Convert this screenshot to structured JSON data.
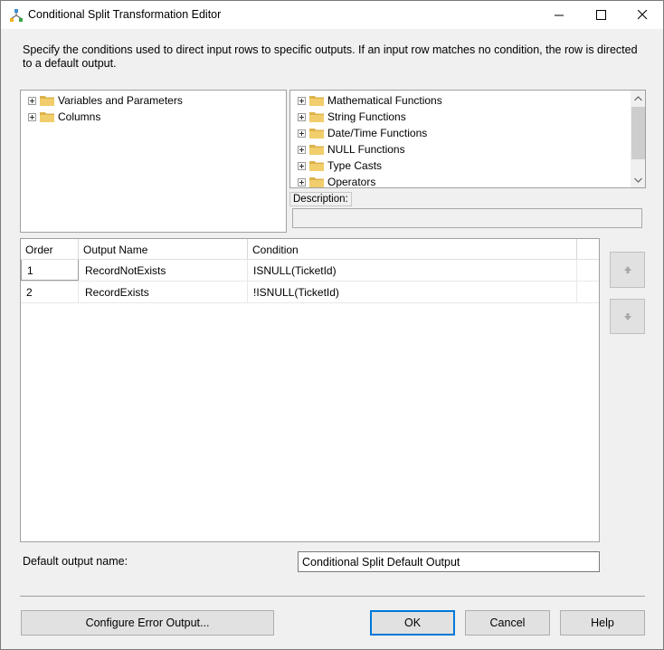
{
  "window": {
    "title": "Conditional Split Transformation Editor",
    "minimize_glyph": "—",
    "maximize_glyph": "☐",
    "close_glyph": "✕",
    "app_icon": "conditional-split-icon"
  },
  "description": "Specify the conditions used to direct input rows to specific outputs. If an input row matches no condition, the row is directed to a default output.",
  "left_tree": {
    "items": [
      {
        "label": "Variables and Parameters",
        "icon": "folder-icon"
      },
      {
        "label": "Columns",
        "icon": "folder-icon"
      }
    ]
  },
  "right_tree": {
    "items": [
      {
        "label": "Mathematical Functions",
        "icon": "folder-icon"
      },
      {
        "label": "String Functions",
        "icon": "folder-icon"
      },
      {
        "label": "Date/Time Functions",
        "icon": "folder-icon"
      },
      {
        "label": "NULL Functions",
        "icon": "folder-icon"
      },
      {
        "label": "Type Casts",
        "icon": "folder-icon"
      },
      {
        "label": "Operators",
        "icon": "folder-icon"
      }
    ]
  },
  "description_panel": {
    "label": "Description:",
    "value": ""
  },
  "grid": {
    "columns": [
      "Order",
      "Output Name",
      "Condition"
    ],
    "rows": [
      {
        "order": "1",
        "name": "RecordNotExists",
        "condition": "ISNULL(TicketId)"
      },
      {
        "order": "2",
        "name": "RecordExists",
        "condition": "!ISNULL(TicketId)"
      }
    ]
  },
  "side_buttons": {
    "up_icon": "arrow-up-icon",
    "down_icon": "arrow-down-icon"
  },
  "default_output": {
    "label": "Default output name:",
    "value": "Conditional Split Default Output"
  },
  "footer": {
    "configure_error": "Configure Error Output...",
    "ok": "OK",
    "cancel": "Cancel",
    "help": "Help"
  },
  "colors": {
    "accent": "#0078d7",
    "folder": "#dcb24a",
    "window_bg": "#f0f0f0"
  }
}
